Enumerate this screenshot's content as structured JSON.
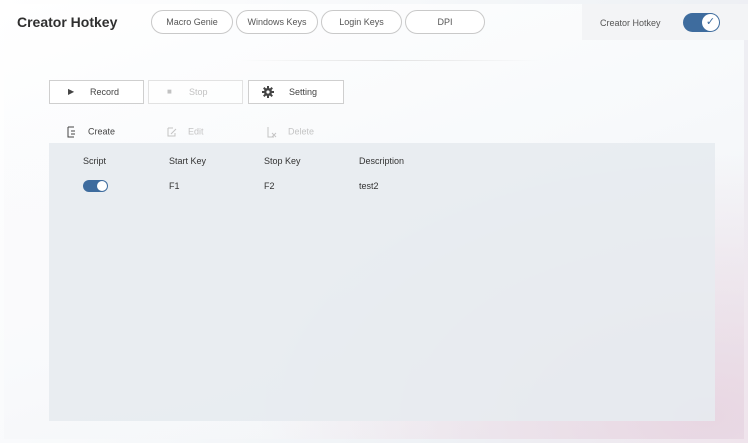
{
  "app": {
    "title": "Creator Hotkey"
  },
  "tabs": [
    {
      "label": "Macro Genie"
    },
    {
      "label": "Windows Keys"
    },
    {
      "label": "Login Keys"
    },
    {
      "label": "DPI"
    }
  ],
  "header": {
    "hotkey_label": "Creator Hotkey",
    "hotkey_enabled": true
  },
  "toolbar": {
    "record_label": "Record",
    "stop_label": "Stop",
    "setting_label": "Setting"
  },
  "actions": {
    "create_label": "Create",
    "edit_label": "Edit",
    "delete_label": "Delete"
  },
  "table": {
    "columns": [
      "Script",
      "Start Key",
      "Stop Key",
      "Description"
    ],
    "rows": [
      {
        "script_enabled": true,
        "start_key": "F1",
        "stop_key": "F2",
        "description": "test2"
      }
    ]
  },
  "colors": {
    "accent": "#3e6c9e"
  }
}
